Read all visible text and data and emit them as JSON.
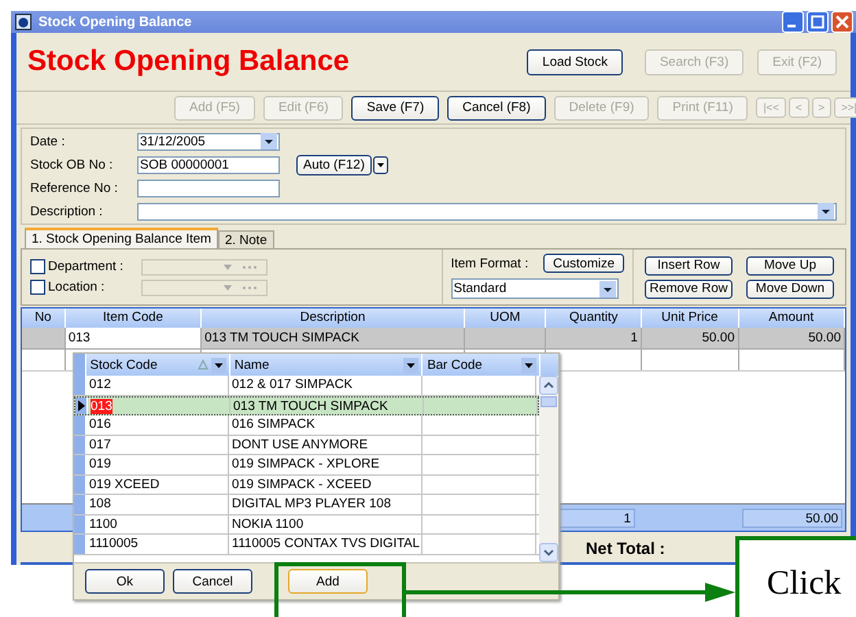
{
  "window": {
    "title": "Stock Opening Balance"
  },
  "header": {
    "title": "Stock Opening Balance",
    "buttons": [
      {
        "label": "Load Stock",
        "disabled": false
      },
      {
        "label": "Search (F3)",
        "disabled": true
      },
      {
        "label": "Exit (F2)",
        "disabled": true
      }
    ]
  },
  "toolbar": [
    {
      "label": "Add (F5)",
      "disabled": true
    },
    {
      "label": "Edit (F6)",
      "disabled": true
    },
    {
      "label": "Save (F7)",
      "disabled": false
    },
    {
      "label": "Cancel (F8)",
      "disabled": false
    },
    {
      "label": "Delete (F9)",
      "disabled": true
    },
    {
      "label": "Print (F11)",
      "disabled": true
    }
  ],
  "nav_buttons": [
    {
      "label": "|<<",
      "disabled": true
    },
    {
      "label": "<",
      "disabled": true
    },
    {
      "label": ">",
      "disabled": true
    },
    {
      "label": ">>|",
      "disabled": true
    }
  ],
  "form": {
    "date": {
      "label": "Date :",
      "value": "31/12/2005"
    },
    "stock_ob_no": {
      "label": "Stock OB No :",
      "value": "SOB 00000001",
      "button": "Auto (F12)"
    },
    "reference_no": {
      "label": "Reference No :"
    },
    "description": {
      "label": "Description :"
    }
  },
  "tabs": [
    {
      "label": "1. Stock Opening Balance Item",
      "selected": true
    },
    {
      "label": "2. Note",
      "selected": false
    }
  ],
  "filters": [
    {
      "label": "Department :",
      "checked": false
    },
    {
      "label": "Location :",
      "checked": false
    }
  ],
  "item_format": {
    "label": "Item Format :",
    "button": "Customize",
    "value": "Standard"
  },
  "row_buttons": [
    "Insert Row",
    "Move Up",
    "Remove Row",
    "Move Down"
  ],
  "grid": {
    "columns": [
      "No",
      "Item Code",
      "Description",
      "UOM",
      "Quantity",
      "Unit Price",
      "Amount"
    ],
    "rows": [
      {
        "item_code": "013",
        "description": "013 TM TOUCH SIMPACK",
        "quantity": "1",
        "unit_price": "50.00",
        "amount": "50.00"
      }
    ],
    "totals": {
      "quantity": "1",
      "amount": "50.00"
    }
  },
  "net_total": {
    "label": "Net Total :"
  },
  "lookup": {
    "columns": [
      "Stock Code",
      "Name",
      "Bar Code"
    ],
    "rows": [
      {
        "stock_code": "012",
        "name": "012 & 017 SIMPACK",
        "selected": false
      },
      {
        "stock_code": "013",
        "name": "013 TM TOUCH SIMPACK",
        "selected": true
      },
      {
        "stock_code": "016",
        "name": "016 SIMPACK",
        "selected": false
      },
      {
        "stock_code": "017",
        "name": "DONT USE ANYMORE",
        "selected": false
      },
      {
        "stock_code": "019",
        "name": "019 SIMPACK - XPLORE",
        "selected": false
      },
      {
        "stock_code": "019 XCEED",
        "name": "019 SIMPACK - XCEED",
        "selected": false
      },
      {
        "stock_code": "108",
        "name": "DIGITAL MP3 PLAYER 108",
        "selected": false
      },
      {
        "stock_code": "1100",
        "name": "NOKIA 1100",
        "selected": false
      },
      {
        "stock_code": "1110005",
        "name": "1110005 CONTAX TVS DIGITAL",
        "selected": false
      }
    ],
    "buttons": [
      "Ok",
      "Cancel",
      "Add"
    ]
  },
  "callout": {
    "text": "Click"
  }
}
